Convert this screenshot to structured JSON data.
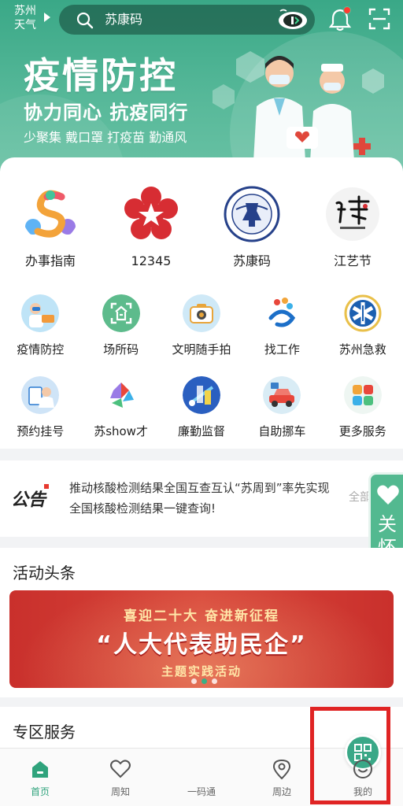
{
  "header": {
    "city_line1": "苏州",
    "city_line2": "天气",
    "search_placeholder": "苏康码",
    "notification_dot_color": "#ff3b30"
  },
  "banner": {
    "title": "疫情防控",
    "subtitle": "协力同心 抗疫同行",
    "tagline": "少聚集 戴口罩 打疫苗 勤通风"
  },
  "featured": [
    {
      "label": "办事指南",
      "icon": "colorful-s-logo-icon"
    },
    {
      "label": "12345",
      "icon": "red-star-flower-icon"
    },
    {
      "label": "苏康码",
      "icon": "health-commission-seal-icon"
    },
    {
      "label": "江艺节",
      "icon": "art-festival-logo-icon"
    }
  ],
  "services": [
    [
      {
        "label": "疫情防控",
        "icon": "epidemic-control-icon"
      },
      {
        "label": "场所码",
        "icon": "place-code-icon"
      },
      {
        "label": "文明随手拍",
        "icon": "camera-icon"
      },
      {
        "label": "找工作",
        "icon": "find-job-icon"
      },
      {
        "label": "苏州急救",
        "icon": "emergency-icon"
      }
    ],
    [
      {
        "label": "预约挂号",
        "icon": "appointment-icon"
      },
      {
        "label": "苏show才",
        "icon": "talent-show-icon"
      },
      {
        "label": "廉勤监督",
        "icon": "supervision-icon"
      },
      {
        "label": "自助挪车",
        "icon": "move-car-icon"
      },
      {
        "label": "更多服务",
        "icon": "more-services-icon"
      }
    ]
  ],
  "notice": {
    "tag": "公告",
    "text": "推动核酸检测结果全国互查互认“苏周到”率先实现全国核酸检测结果一键查询!",
    "more": "全部"
  },
  "care_mode": {
    "label": "关怀模式"
  },
  "activity": {
    "title": "活动头条",
    "banner_line1": "喜迎二十大 奋进新征程",
    "banner_line2": "“人大代表助民企”",
    "banner_line3": "主题实践活动"
  },
  "zone": {
    "title": "专区服务"
  },
  "tabbar": {
    "home": "首页",
    "notice": "周知",
    "code": "一码通",
    "nearby": "周边",
    "mine": "我的"
  },
  "colors": {
    "brand": "#3aa887",
    "active_tab": "#2fa37c",
    "highlight": "#e02424"
  }
}
